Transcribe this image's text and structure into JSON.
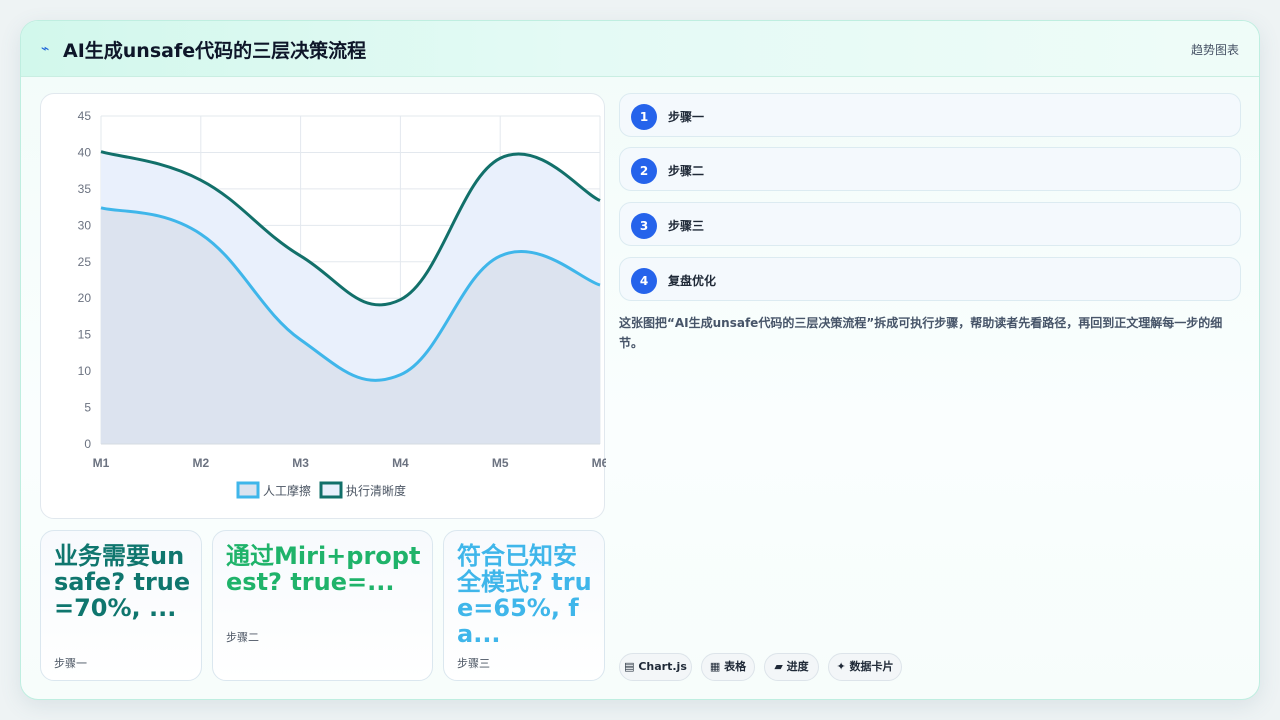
{
  "header": {
    "icon": "trend-icon",
    "title": "AI生成unsafe代码的三层决策流程",
    "tag": "趋势图表"
  },
  "chart_data": {
    "type": "line",
    "categories": [
      "M1",
      "M2",
      "M3",
      "M4",
      "M5",
      "M6"
    ],
    "y_ticks": [
      "0",
      "5",
      "10",
      "15",
      "20",
      "25",
      "30",
      "35",
      "40",
      "45"
    ],
    "ylim": [
      0,
      45
    ],
    "grid": true,
    "legend_position": "bottom",
    "series": [
      {
        "name": "人工摩擦",
        "values": [
          32.4,
          28.8,
          14.3,
          9.5,
          25.8,
          21.8
        ],
        "color": "#3fb6ea",
        "fill": "#dce3ef"
      },
      {
        "name": "执行清晰度",
        "values": [
          40.1,
          36.2,
          25.8,
          19.8,
          39.2,
          33.4
        ],
        "color": "#12706a",
        "fill": "#e9f0fc"
      }
    ]
  },
  "cards": [
    {
      "text": "业务需要unsafe? true=70%, ...",
      "label": "步骤一",
      "color": "#0f766e"
    },
    {
      "text": "通过Miri+proptest? true=...",
      "label": "步骤二",
      "color": "#1fb36a"
    },
    {
      "text": "符合已知安全模式? true=65%, fa...",
      "label": "步骤三",
      "color": "#3fb6ea"
    }
  ],
  "steps": [
    {
      "num": "1",
      "label": "步骤一"
    },
    {
      "num": "2",
      "label": "步骤二"
    },
    {
      "num": "3",
      "label": "步骤三"
    },
    {
      "num": "4",
      "label": "复盘优化"
    }
  ],
  "description": "这张图把“AI生成unsafe代码的三层决策流程”拆成可执行步骤，帮助读者先看路径，再回到正文理解每一步的细节。",
  "pills": [
    {
      "icon": "chart-icon",
      "glyph": "▤",
      "label": "Chart.js"
    },
    {
      "icon": "table-icon",
      "glyph": "▦",
      "label": "表格"
    },
    {
      "icon": "progress-icon",
      "glyph": "▰",
      "label": "进度"
    },
    {
      "icon": "sparkle-icon",
      "glyph": "✦",
      "label": "数据卡片"
    }
  ]
}
